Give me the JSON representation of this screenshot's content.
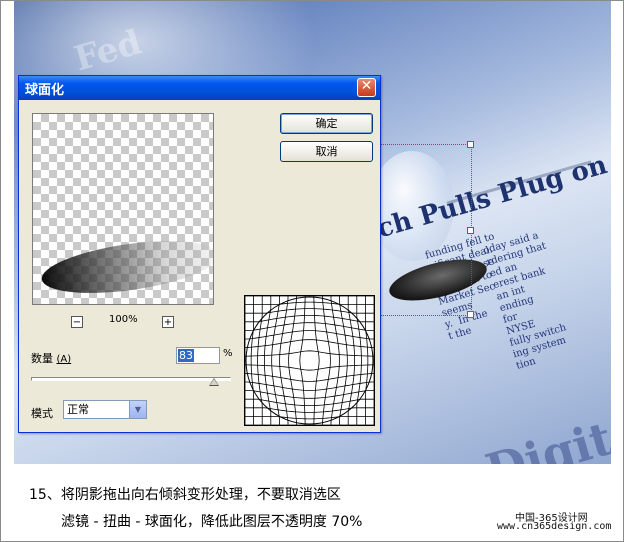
{
  "dialog": {
    "title": "球面化",
    "close_glyph": "✕",
    "ok_label": "确定",
    "cancel_label": "取消",
    "zoom_out": "−",
    "zoom_in": "+",
    "zoom_value": "100%",
    "amount_label": "数量",
    "amount_accel": "(A)",
    "amount_value": "83",
    "amount_unit": "%",
    "amount_slider_fraction": 0.915,
    "mode_label": "模式",
    "mode_selected": "正常"
  },
  "icons": [
    "close-icon",
    "chevron-down-icon",
    "zoom-out-icon",
    "zoom-in-icon"
  ],
  "photo_text": {
    "headline": "ach Pulls Plug on H",
    "digital": "Digital"
  },
  "caption": {
    "line1": "15、将阴影拖出向右倾斜变形处理，不要取消选区",
    "line2": "滤镜 - 扭曲 - 球面化，降低此图层不透明度 70%"
  },
  "watermark": {
    "line1": "中国-365设计网",
    "line2": "www.cn365design.com"
  },
  "colors": {
    "titlebar": "#0054e3",
    "dialog_bg": "#ece9d8",
    "selection": "#b0307a"
  }
}
